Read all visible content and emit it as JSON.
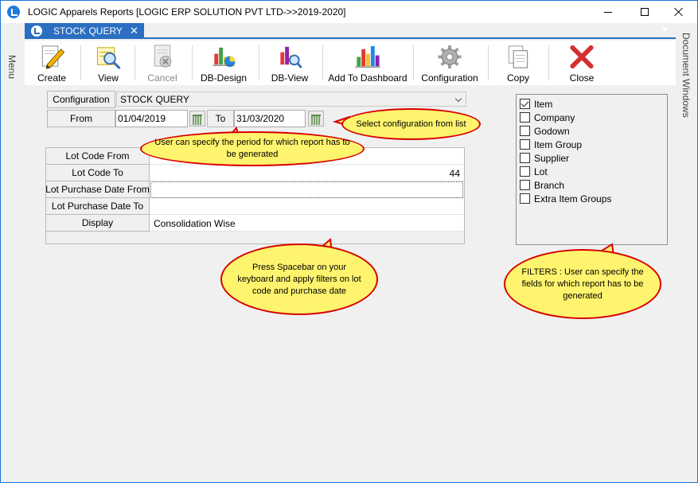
{
  "window": {
    "title": "LOGIC Apparels Reports  [LOGIC ERP SOLUTION PVT LTD->>2019-2020]",
    "menu_label": "Menu",
    "document_windows_label": "Document Windows"
  },
  "tab": {
    "label": "STOCK QUERY",
    "close": "✕"
  },
  "toolbar": {
    "create": "Create",
    "view": "View",
    "cancel": "Cancel",
    "db_design": "DB-Design",
    "db_view": "DB-View",
    "add_dashboard": "Add To Dashboard",
    "configuration": "Configuration",
    "copy": "Copy",
    "close": "Close"
  },
  "form": {
    "configuration_label": "Configuration",
    "configuration_value": "STOCK QUERY",
    "from_label": "From",
    "from_value": "01/04/2019",
    "to_label": "To",
    "to_value": "31/03/2020"
  },
  "grid": {
    "rows": [
      {
        "label": "Lot Code From",
        "value": ""
      },
      {
        "label": "Lot Code To",
        "value": "44"
      },
      {
        "label": "Lot Purchase Date From",
        "value": ""
      },
      {
        "label": "Lot Purchase Date To",
        "value": ""
      },
      {
        "label": "Display",
        "value": "Consolidation Wise"
      }
    ]
  },
  "filters": [
    {
      "label": "Item",
      "checked": true
    },
    {
      "label": "Company",
      "checked": false
    },
    {
      "label": "Godown",
      "checked": false
    },
    {
      "label": "Item Group",
      "checked": false
    },
    {
      "label": "Supplier",
      "checked": false
    },
    {
      "label": "Lot",
      "checked": false
    },
    {
      "label": "Branch",
      "checked": false
    },
    {
      "label": "Extra Item Groups",
      "checked": false
    }
  ],
  "callouts": {
    "period": "User can specify the period for which report has to be generated",
    "config": "Select configuration from list",
    "spacebar": "Press Spacebar on your keyboard and apply filters on lot code and purchase date",
    "filters": "FILTERS : User can specify the fields for which report has to be generated"
  },
  "colors": {
    "accent": "#2b6fc2",
    "callout_fill": "#fff46e",
    "callout_border": "#d80000"
  }
}
